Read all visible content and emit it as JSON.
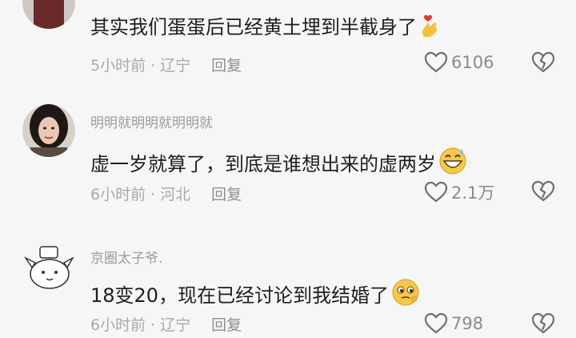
{
  "comments": [
    {
      "username": "",
      "text": "其实我们蛋蛋后已经黄土埋到半截身了",
      "time": "5小时前",
      "location": "辽宁",
      "reply_label": "回复",
      "likes": "6106",
      "emoji": "finger-heart-emoji"
    },
    {
      "username": "明明就明明就明明就",
      "text": "虚一岁就算了，到底是谁想出来的虚两岁",
      "time": "6小时前",
      "location": "河北",
      "reply_label": "回复",
      "likes": "2.1万",
      "emoji": "sweat-grin-emoji"
    },
    {
      "username": "京圈太子爷.",
      "text": "18变20，现在已经讨论到我结婚了",
      "time": "6小时前",
      "location": "辽宁",
      "reply_label": "回复",
      "likes": "798",
      "emoji": "peek-face-emoji"
    }
  ],
  "icons": {
    "like": "heart-outline-icon",
    "dislike": "broken-heart-icon"
  },
  "colors": {
    "background": "#f6f6f6",
    "meta": "#a8a8ae",
    "text": "#1e1e1e"
  }
}
